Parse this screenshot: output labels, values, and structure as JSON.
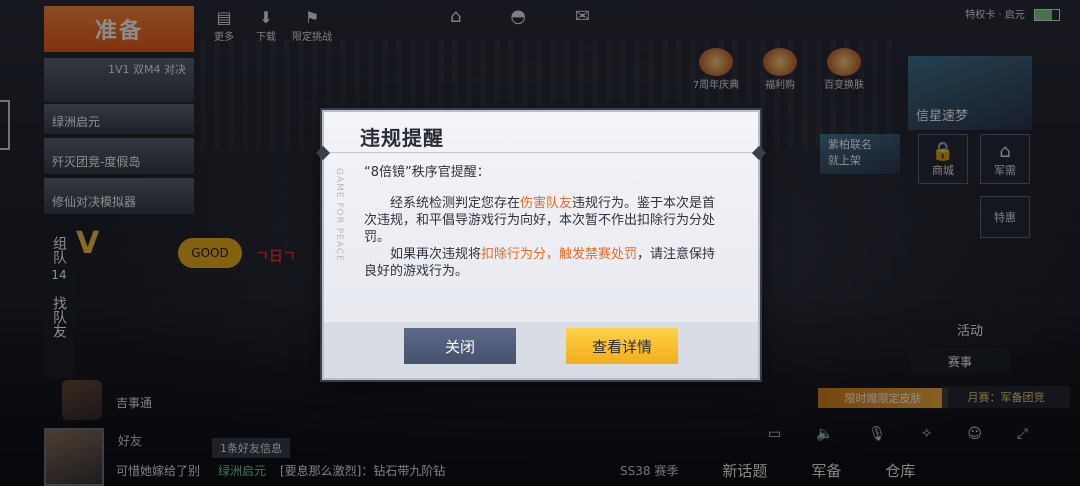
{
  "lobby": {
    "prepare_label": "准备",
    "top_icons": [
      {
        "icon": "more-icon",
        "label": "更多"
      },
      {
        "icon": "download-icon",
        "label": "下载"
      },
      {
        "icon": "challenge-icon",
        "label": "限定挑战"
      }
    ],
    "modes": [
      {
        "title": "1V1 双M4 对决",
        "label": ""
      },
      {
        "title": "",
        "label": "绿洲启元"
      },
      {
        "title": "",
        "label": "歼灭团竞-度假岛"
      },
      {
        "title": "",
        "label": "修仙对决模拟器"
      }
    ],
    "team": {
      "label": "组队",
      "count": "14",
      "find_label": "找队友"
    },
    "logo_b_text": "GOOD",
    "logo_c_text": "ㄱ日ㄱ",
    "player_chip_name": "吉事通",
    "friends": {
      "label": "好友",
      "badge": "1条好友信息",
      "msg_user": "可惜她嫁给了别",
      "msg_mode": "绿洲启元",
      "msg_text": "[要息那么激烈]：钻石带九阶钻"
    }
  },
  "status_bar": {
    "signal_text": "特权卡 · 启元",
    "battery_level": 0.7
  },
  "events": [
    {
      "label": "7周年庆典"
    },
    {
      "label": "福利购"
    },
    {
      "label": "百变换肤"
    }
  ],
  "right_panel": {
    "card_top": "信星速梦",
    "card_promo": "紫柏联名\n就上架",
    "shop_label": "商城",
    "armory_label": "军需",
    "special_label": "特惠",
    "activity_label": "活动",
    "event_label": "赛事",
    "promo_strip": "限时赠限定皮肤",
    "monthly_label": "月赛：军备团竞"
  },
  "bottom_nav": {
    "season": "SS38 赛季",
    "new_topic": "新话题",
    "armory": "军备",
    "warehouse": "仓库"
  },
  "modal": {
    "title": "违规提醒",
    "side_text": "GAME FOR PEACE",
    "greeting": "“8倍镜”秩序官提醒：",
    "p1_prefix": "经系统检测判定您存在",
    "p1_highlight": "伤害队友",
    "p1_suffix": "违规行为。鉴于本次是首次违规，和平倡导游戏行为向好，本次暂不作出扣除行为分处罚。",
    "p2_prefix": "如果再次违规将",
    "p2_highlight": "扣除行为分，触发禁赛处罚",
    "p2_suffix": "，请注意保持良好的游戏行为。",
    "close_label": "关闭",
    "detail_label": "查看详情"
  }
}
